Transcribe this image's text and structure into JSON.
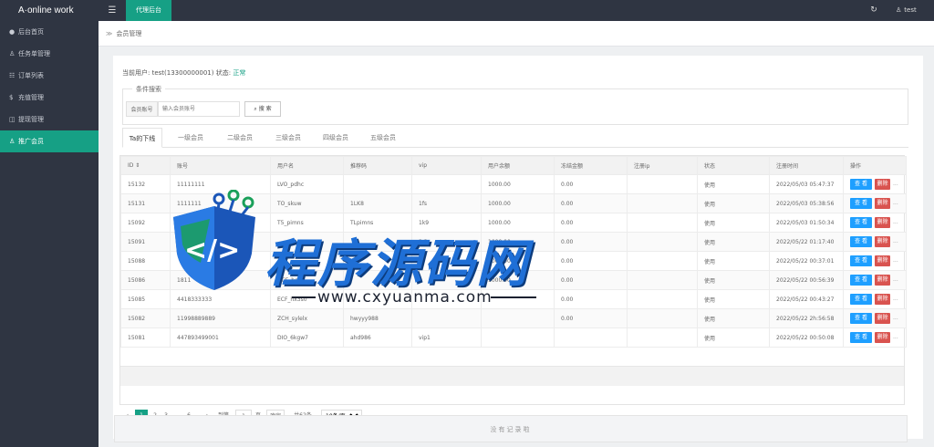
{
  "app": {
    "title": "A·online work",
    "menu_icon": "hamburger-icon"
  },
  "topbar": {
    "tab": "代理后台",
    "refresh_icon": "refresh-icon",
    "user_icon": "user-icon",
    "user_name": "test"
  },
  "sidebar": {
    "items": [
      {
        "label": "后台首页",
        "icon": "home-icon",
        "active": false
      },
      {
        "label": "任务单管理",
        "icon": "user-icon",
        "active": false
      },
      {
        "label": "订单列表",
        "icon": "list-icon",
        "active": false
      },
      {
        "label": "充值管理",
        "icon": "dollar-icon",
        "active": false
      },
      {
        "label": "提现管理",
        "icon": "wallet-icon",
        "active": false
      },
      {
        "label": "推广会员",
        "icon": "user-icon",
        "active": true
      }
    ]
  },
  "breadcrumb": {
    "separator": "≫",
    "label": "会员管理"
  },
  "current_user": {
    "prefix": "当前用户:",
    "value": "test(13300000001)",
    "status_prefix": "状态:",
    "status": "正常"
  },
  "search": {
    "legend": "条件搜索",
    "label": "会员账号",
    "placeholder": "输入会员账号",
    "button": "搜 索",
    "button_icon": "search-icon"
  },
  "tabs": [
    "Ta的下线",
    "一级会员",
    "二级会员",
    "三级会员",
    "四级会员",
    "五级会员"
  ],
  "table": {
    "columns": [
      "ID ⇕",
      "账号",
      "用户名",
      "推荐码",
      "vip",
      "用户余额",
      "冻结金额",
      "注册ip",
      "状态",
      "注册时间",
      "操作"
    ],
    "rows": [
      [
        "15132",
        "11111111",
        "LVO_pdhc",
        "",
        "",
        "1000.00",
        "0.00",
        "",
        "使用",
        "2022/05/03 05:47:37"
      ],
      [
        "15131",
        "1111111",
        "TO_skuw",
        "1LK8",
        "1fs",
        "1000.00",
        "0.00",
        "",
        "使用",
        "2022/05/03 05:38:56"
      ],
      [
        "15092",
        "",
        "T5_pimns",
        "TLpimns",
        "1k9",
        "1000.00",
        "0.00",
        "",
        "使用",
        "2022/05/03 01:50:34"
      ],
      [
        "15091",
        "",
        "",
        "",
        "3.3",
        "1000.00",
        "0.00",
        "",
        "使用",
        "2022/05/22 01:17:40"
      ],
      [
        "15088",
        "",
        "",
        "",
        "",
        "1000.00",
        "0.00",
        "",
        "使用",
        "2022/05/22 00:37:01"
      ],
      [
        "15086",
        "1811",
        "DCF_hoky",
        "",
        "",
        "1000.00",
        "0.00",
        "",
        "使用",
        "2022/05/22 00:56:39"
      ],
      [
        "15085",
        "4418333333",
        "ECF_hx3s0",
        "",
        "",
        "",
        "0.00",
        "",
        "使用",
        "2022/05/22 00:43:27"
      ],
      [
        "15082",
        "11998889889",
        "ZCH_sylelx",
        "hwyyy988",
        "",
        "",
        "0.00",
        "",
        "使用",
        "2022/05/22 2h:56:58"
      ],
      [
        "15081",
        "447893499001",
        "DIO_6kgw7",
        "ahd986",
        "vip1",
        "",
        "",
        "",
        "使用",
        "2022/05/22 00:50:08"
      ]
    ],
    "view_label": "查 看",
    "delete_label": "删除",
    "more_label": "..."
  },
  "pagination": {
    "prev": "‹",
    "pages": [
      "1",
      "2",
      "3",
      "...",
      "6"
    ],
    "next": "›",
    "goto_label": "到第",
    "goto_value": "1",
    "page_unit": "页",
    "confirm": "确定",
    "total": "共62条",
    "per_page": "10条/页"
  },
  "bottom": {
    "text": "没有记录啦"
  },
  "watermark": {
    "title": "程序源码网",
    "url": "www.cxyuanma.com"
  }
}
